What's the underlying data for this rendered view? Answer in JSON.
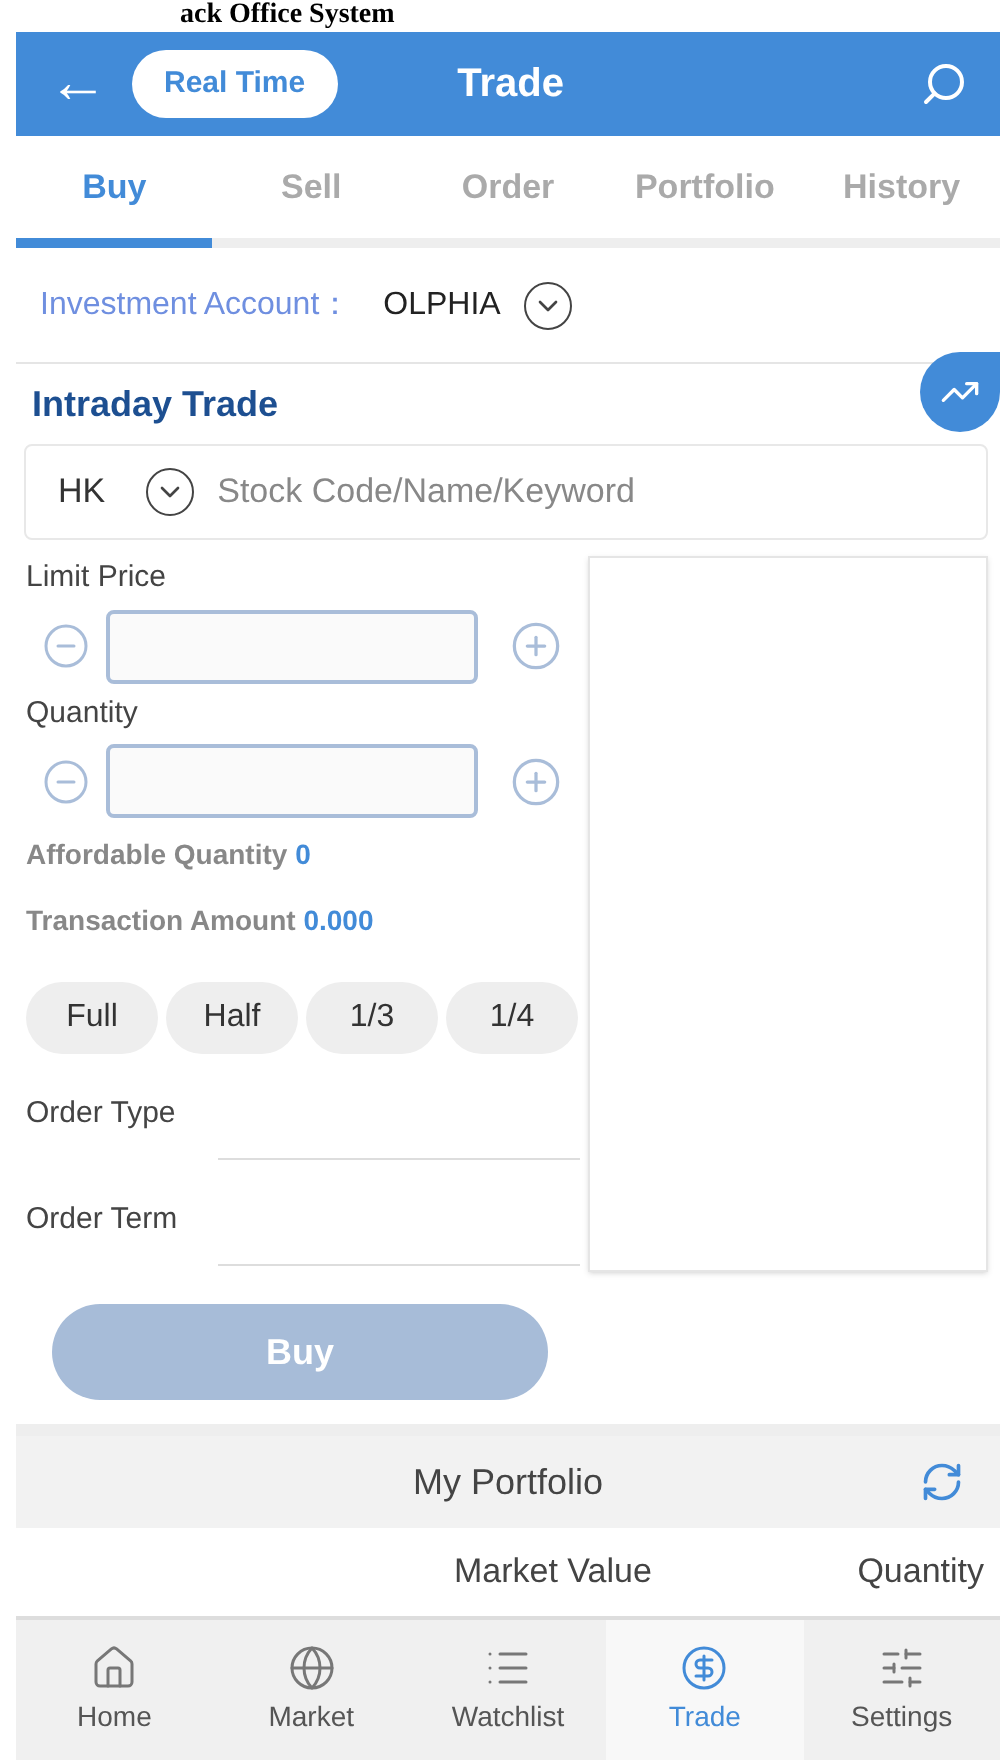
{
  "page_title": "ack Office System",
  "header": {
    "back": "←",
    "mode_button": "Real Time",
    "title": "Trade"
  },
  "tabs": [
    {
      "label": "Buy",
      "selected": true
    },
    {
      "label": "Sell",
      "selected": false
    },
    {
      "label": "Order",
      "selected": false
    },
    {
      "label": "Portfolio",
      "selected": false
    },
    {
      "label": "History",
      "selected": false
    }
  ],
  "account": {
    "label": "Investment Account：",
    "value": "OLPHIA"
  },
  "intraday": {
    "title": "Intraday Trade",
    "market": "HK",
    "search_placeholder": "Stock Code/Name/Keyword",
    "limit_price": {
      "label": "Limit Price"
    },
    "quantity": {
      "label": "Quantity"
    },
    "affordable": {
      "label": "Affordable Quantity",
      "value": "0"
    },
    "amount": {
      "label": "Transaction Amount",
      "value": "0.000"
    },
    "ratios": [
      "Full",
      "Half",
      "1/3",
      "1/4"
    ],
    "order_type": {
      "label": "Order Type"
    },
    "order_term": {
      "label": "Order Term"
    },
    "submit": {
      "label": "Buy",
      "disabled": true
    }
  },
  "portfolio": {
    "title": "My Portfolio",
    "columns": [
      "Market Value",
      "Quantity"
    ]
  },
  "nav": [
    {
      "label": "Home",
      "kind": "home",
      "selected": false
    },
    {
      "label": "Market",
      "kind": "market",
      "selected": false
    },
    {
      "label": "Watchlist",
      "kind": "watchlist",
      "selected": false
    },
    {
      "label": "Trade",
      "kind": "trade",
      "selected": true
    },
    {
      "label": "Settings",
      "kind": "settings",
      "selected": false
    }
  ]
}
